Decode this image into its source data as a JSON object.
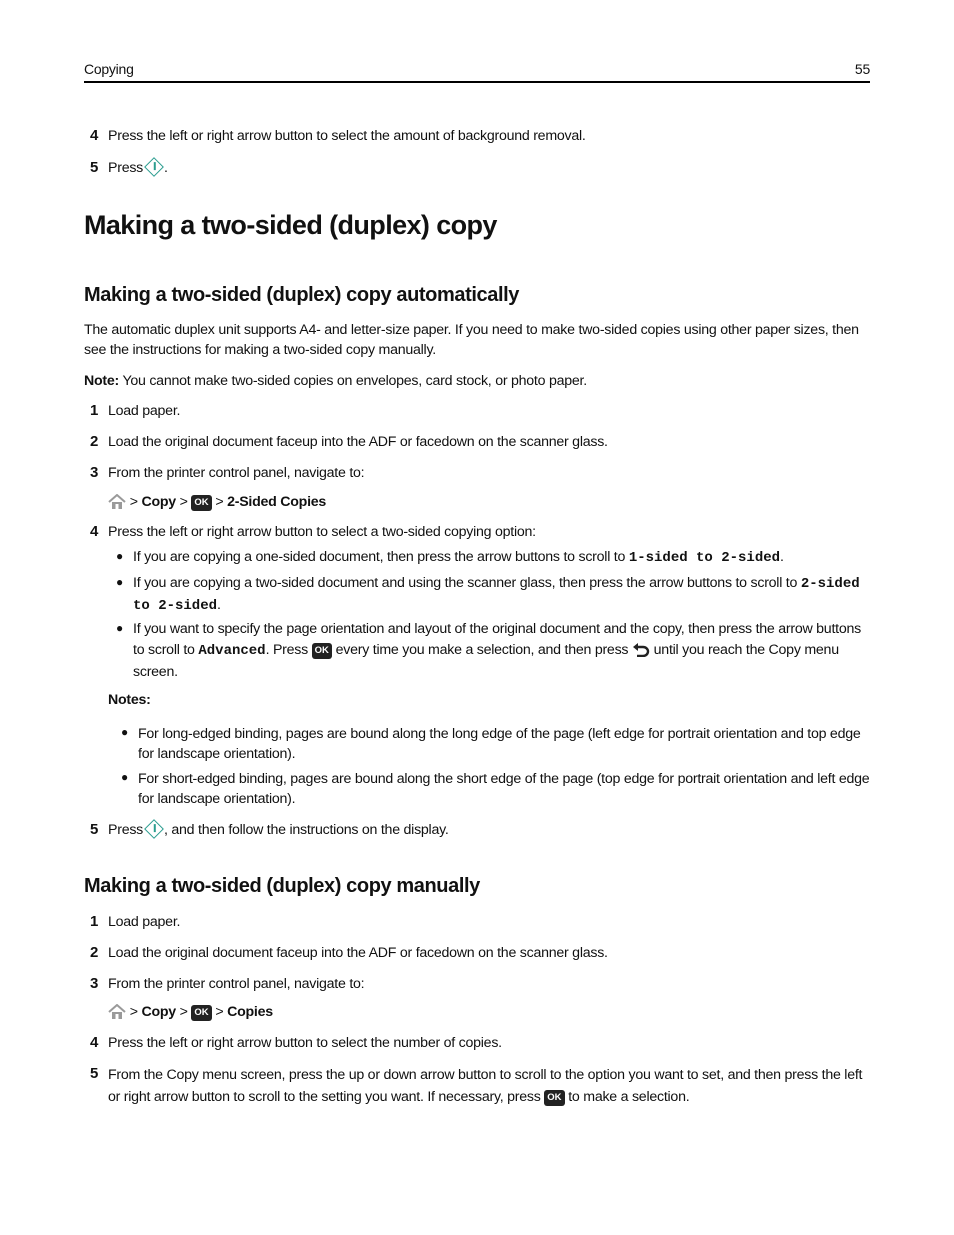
{
  "header": {
    "section": "Copying",
    "page_number": "55"
  },
  "prev_steps": [
    {
      "num": "4",
      "text": "Press the left or right arrow button to select the amount of background removal."
    },
    {
      "num": "5",
      "pre": "Press",
      "post": "."
    }
  ],
  "title": "Making a two-sided (duplex) copy",
  "auto": {
    "heading": "Making a two-sided (duplex) copy automatically",
    "intro": "The automatic duplex unit supports A4- and letter-size paper. If you need to make two-sided copies using other paper sizes, then see the instructions for making a two-sided copy manually.",
    "note_label": "Note:",
    "note_text": " You cannot make two-sided copies on envelopes, card stock, or photo paper.",
    "steps": [
      {
        "num": "1",
        "text": "Load paper."
      },
      {
        "num": "2",
        "text": "Load the original document faceup into the ADF or facedown on the scanner glass."
      },
      {
        "num": "3",
        "text": "From the printer control panel, navigate to:"
      },
      {
        "num": "4",
        "text": "Press the left or right arrow button to select a two-sided copying option:"
      },
      {
        "num": "5",
        "pre": "Press",
        "post": ", and then follow the instructions on the display."
      }
    ],
    "nav_path": {
      "sep": ">",
      "copy": "Copy",
      "ok": "OK",
      "target": "2-Sided Copies"
    },
    "bullets": [
      {
        "pre": "If you are copying a one-sided document, then press the arrow buttons to scroll to ",
        "code": "1-sided to 2-sided",
        "post": "."
      },
      {
        "pre": "If you are copying a two-sided document and using the scanner glass, then press the arrow buttons to scroll to ",
        "code": "2-sided to 2-sided",
        "post": "."
      },
      {
        "pre": "If you want to specify the page orientation and layout of the original document and the copy, then press the arrow buttons to scroll to ",
        "code": "Advanced",
        "mid": ". Press ",
        "ok": "OK",
        "mid2": " every time you make a selection, and then press ",
        "post": " until you reach the Copy menu screen."
      }
    ],
    "notes_label": "Notes:",
    "notes": [
      "For long-edged binding, pages are bound along the long edge of the page (left edge for portrait orientation and top edge for landscape orientation).",
      "For short-edged binding, pages are bound along the short edge of the page (top edge for portrait orientation and left edge for landscape orientation)."
    ]
  },
  "manual": {
    "heading": "Making a two-sided (duplex) copy manually",
    "steps": [
      {
        "num": "1",
        "text": "Load paper."
      },
      {
        "num": "2",
        "text": "Load the original document faceup into the ADF or facedown on the scanner glass."
      },
      {
        "num": "3",
        "text": "From the printer control panel, navigate to:"
      },
      {
        "num": "4",
        "text": "Press the left or right arrow button to select the number of copies."
      },
      {
        "num": "5",
        "pre": "From the Copy menu screen, press the up or down arrow button to scroll to the option you want to set, and then press the left or right arrow button to scroll to the setting you want. If necessary, press ",
        "ok": "OK",
        "post": " to make a selection."
      }
    ],
    "nav_path": {
      "sep": ">",
      "copy": "Copy",
      "ok": "OK",
      "target": "Copies"
    }
  },
  "colors": {
    "start_icon": "#2a9d8f",
    "ok_icon_bg": "#222222",
    "home_icon": "#9a9a9a"
  }
}
